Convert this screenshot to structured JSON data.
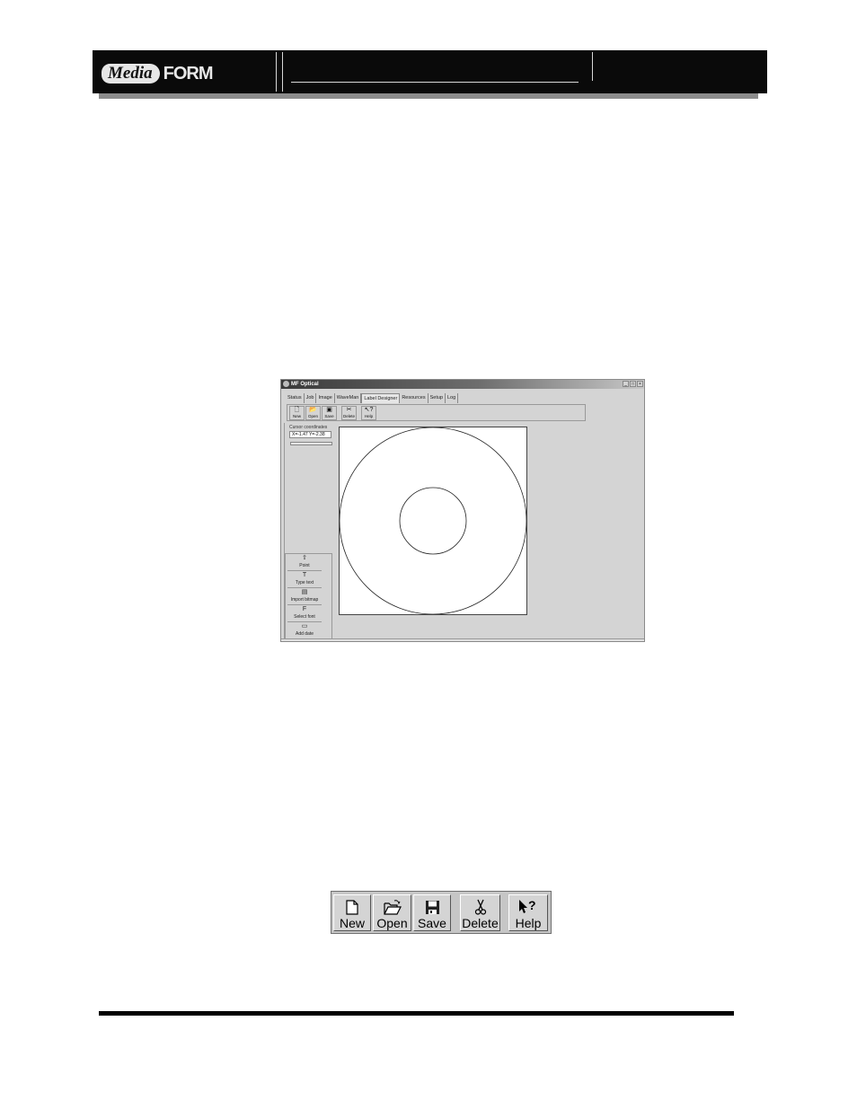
{
  "header": {
    "logo_media": "Media",
    "logo_form": "FORM"
  },
  "window": {
    "title": "MF Optical",
    "controls": [
      "_",
      "□",
      "×"
    ],
    "tabs": [
      "Status",
      "Job",
      "Image",
      "WaveMan",
      "Label Designer",
      "Resources",
      "Setup",
      "Log"
    ],
    "active_tab": "Label Designer",
    "small_toolbar": [
      {
        "label": "New",
        "icon": "new-file-icon"
      },
      {
        "label": "Open",
        "icon": "open-folder-icon"
      },
      {
        "label": "Save",
        "icon": "floppy-disk-icon"
      },
      {
        "label": "Delete",
        "icon": "scissors-icon"
      },
      {
        "label": "Help",
        "icon": "help-pointer-icon"
      }
    ],
    "cursor_label": "Cursor coordinates",
    "cursor_value": "X=-1.47 Y=-2.38",
    "tools": [
      {
        "label": "Point",
        "glyph": "⇧"
      },
      {
        "label": "Type text",
        "glyph": "T"
      },
      {
        "label": "Import bitmap",
        "glyph": "▤"
      },
      {
        "label": "Select font",
        "glyph": "F"
      },
      {
        "label": "Add date",
        "glyph": "▭"
      }
    ]
  },
  "toolbar": {
    "new_label": "New",
    "open_label": "Open",
    "save_label": "Save",
    "delete_label": "Delete",
    "help_label": "Help"
  }
}
